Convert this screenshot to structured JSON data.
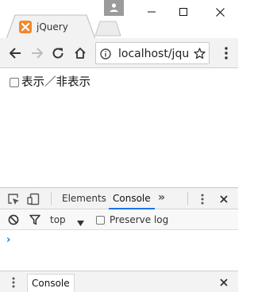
{
  "browser": {
    "tab_title": "jQuery",
    "tab_favicon": "xampp-icon",
    "url": "localhost/jquery",
    "icons": {
      "back": "back-arrow-icon",
      "forward": "forward-arrow-icon",
      "reload": "reload-icon",
      "home": "home-icon",
      "info": "info-icon",
      "bookmark": "star-icon",
      "menu": "kebab-menu-icon",
      "profile": "person-icon"
    },
    "colors": {
      "favicon": "#f28a2b",
      "profile": "#9b9b9b",
      "accent": "#1a73e8"
    }
  },
  "page": {
    "toggle_checkbox": {
      "checked": false,
      "label": "表示／非表示"
    }
  },
  "devtools": {
    "tabs": [
      {
        "label": "Elements",
        "active": false
      },
      {
        "label": "Console",
        "active": true
      }
    ],
    "more_tabs": "»",
    "console": {
      "context": "top",
      "preserve_log_label": "Preserve log",
      "preserve_log_checked": false,
      "prompt": "›"
    },
    "drawer": {
      "tab_label": "Console"
    }
  }
}
